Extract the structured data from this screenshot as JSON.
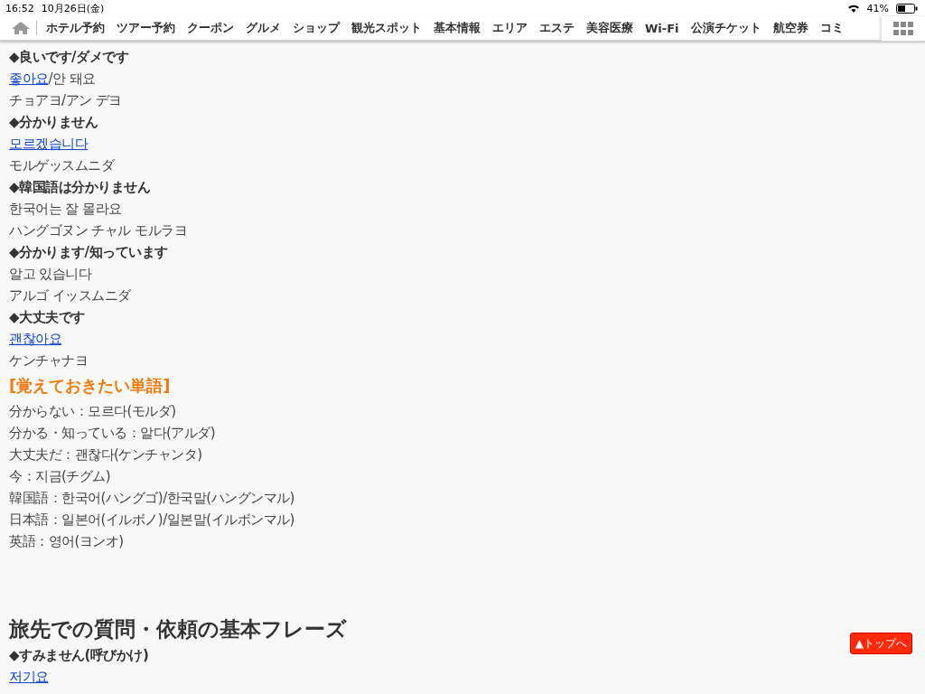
{
  "status_bar": {
    "time": "16:52",
    "date": "10月26日(金)",
    "battery": "41%"
  },
  "nav": {
    "items": [
      "ホテル予約",
      "ツアー予約",
      "クーポン",
      "グルメ",
      "ショップ",
      "観光スポット",
      "基本情報",
      "エリア",
      "エステ",
      "美容医療",
      "Wi-Fi",
      "公演チケット",
      "航空券",
      "コミ"
    ]
  },
  "content": [
    {
      "kind": "phrase",
      "text": "◆良いです/ダメです"
    },
    {
      "kind": "mixed",
      "link": "좋아요",
      "rest": "/안 돼요"
    },
    {
      "kind": "text",
      "text": "チョアヨ/アン デヨ"
    },
    {
      "kind": "phrase",
      "text": "◆分かりません"
    },
    {
      "kind": "link",
      "text": "모르겠습니다"
    },
    {
      "kind": "text",
      "text": "モルゲッスムニダ"
    },
    {
      "kind": "phrase",
      "text": "◆韓国語は分かりません"
    },
    {
      "kind": "text",
      "text": "한국어는 잘 몰라요"
    },
    {
      "kind": "text",
      "text": "ハングゴヌン チャル モルラヨ"
    },
    {
      "kind": "phrase",
      "text": "◆分かります/知っています"
    },
    {
      "kind": "text",
      "text": "알고 있습니다"
    },
    {
      "kind": "text",
      "text": "アルゴ イッスムニダ"
    },
    {
      "kind": "phrase",
      "text": "◆大丈夫です"
    },
    {
      "kind": "link",
      "text": "괜찮아요"
    },
    {
      "kind": "text",
      "text": "ケンチャナヨ"
    },
    {
      "kind": "subtitle",
      "text": "[覚えておきたい単語]"
    },
    {
      "kind": "text",
      "text": "分からない：모르다(モルダ)"
    },
    {
      "kind": "text",
      "text": "分かる・知っている：알다(アルダ)"
    },
    {
      "kind": "text",
      "text": "大丈夫だ：괜찮다(ケンチャンタ)"
    },
    {
      "kind": "text",
      "text": "今：지금(チグム)"
    },
    {
      "kind": "text",
      "text": "韓国語：한국어(ハングゴ)/한국말(ハングンマル)"
    },
    {
      "kind": "text",
      "text": "日本語：일본어(イルボノ)/일본말(イルボンマル)"
    },
    {
      "kind": "text",
      "text": "英語：영어(ヨンオ)"
    },
    {
      "kind": "heading",
      "text": "旅先での質問・依頼の基本フレーズ"
    },
    {
      "kind": "phrase",
      "text": "◆すみません(呼びかけ)"
    },
    {
      "kind": "link",
      "text": "저기요"
    }
  ],
  "top_button": {
    "label": "▲トップへ"
  }
}
